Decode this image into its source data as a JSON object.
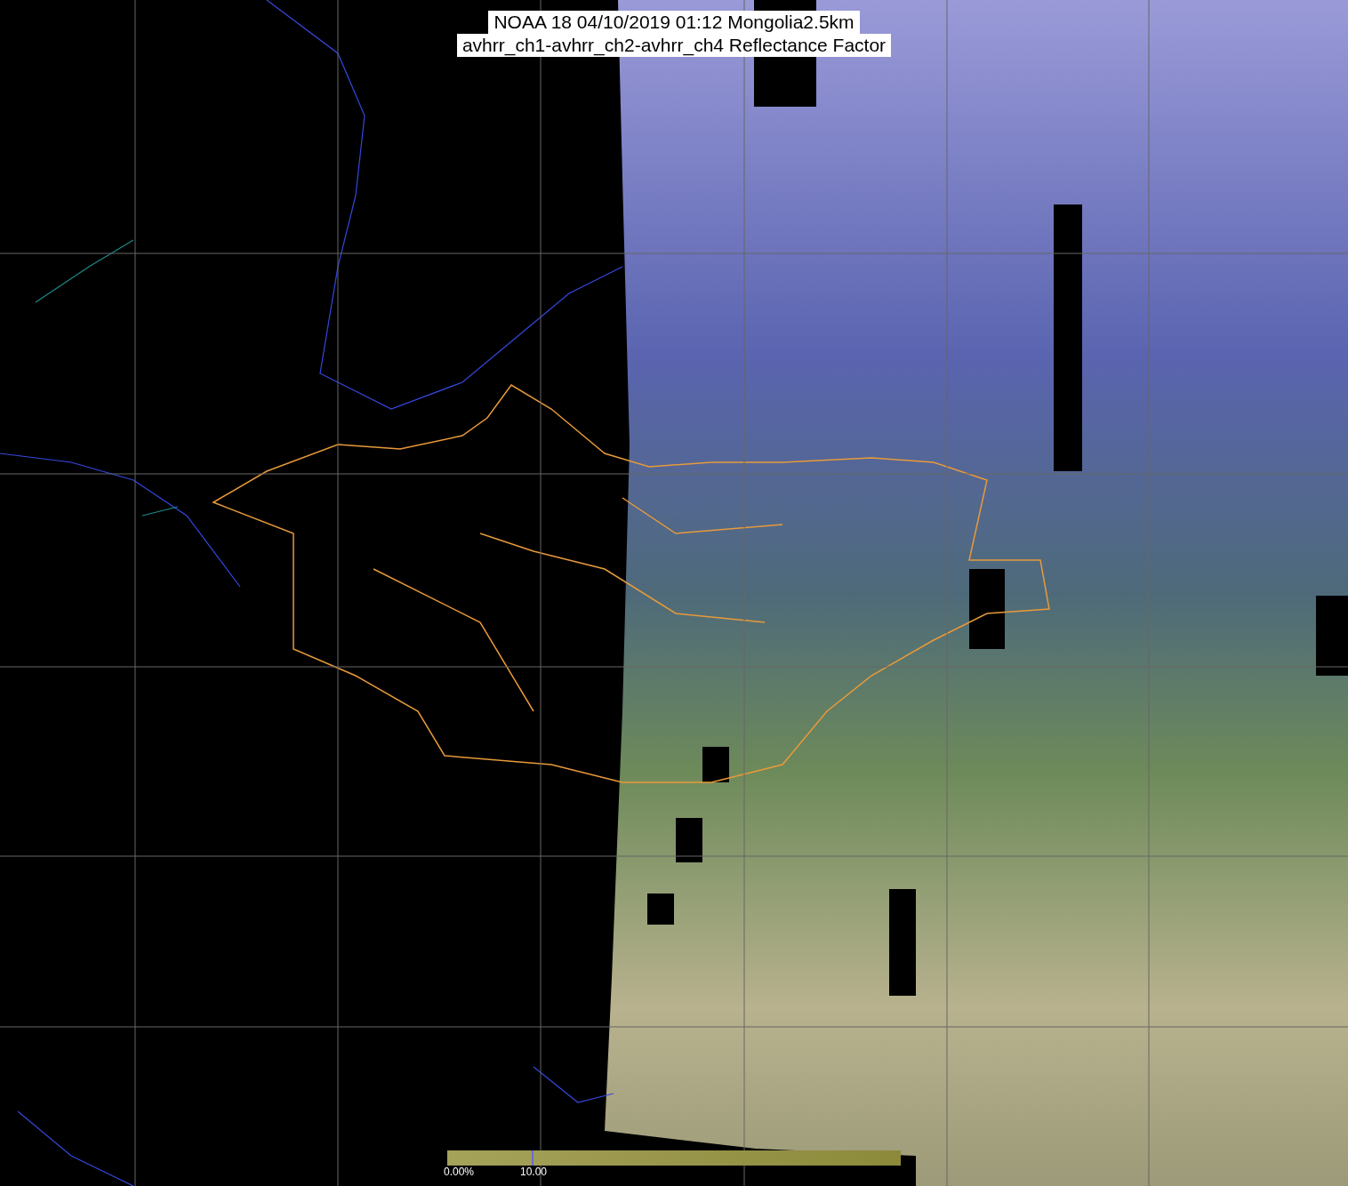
{
  "title": {
    "lines": [
      "NOAA 18 04/10/2019 01:12 Mongolia2.5km",
      "avhrr_ch1-avhrr_ch2-avhrr_ch4 Reflectance Factor"
    ]
  },
  "colorbar": {
    "labels": [
      "0.00%",
      "10.00"
    ]
  }
}
